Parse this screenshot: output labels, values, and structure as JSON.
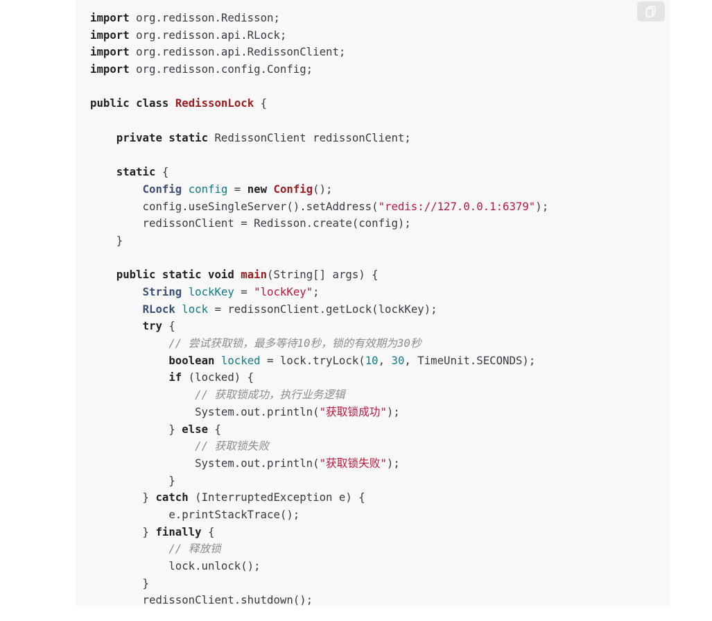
{
  "copy_button": {
    "icon": "copy-icon"
  },
  "code_lines": [
    [
      [
        "kw",
        "import"
      ],
      [
        "pl",
        " org.redisson.Redisson;"
      ]
    ],
    [
      [
        "kw",
        "import"
      ],
      [
        "pl",
        " org.redisson.api.RLock;"
      ]
    ],
    [
      [
        "kw",
        "import"
      ],
      [
        "pl",
        " org.redisson.api.RedissonClient;"
      ]
    ],
    [
      [
        "kw",
        "import"
      ],
      [
        "pl",
        " org.redisson.config.Config;"
      ]
    ],
    [],
    [
      [
        "kw",
        "public"
      ],
      [
        "pl",
        " "
      ],
      [
        "kw",
        "class"
      ],
      [
        "pl",
        " "
      ],
      [
        "cls",
        "RedissonLock"
      ],
      [
        "pl",
        " {"
      ]
    ],
    [],
    [
      [
        "pl",
        "    "
      ],
      [
        "kw",
        "private"
      ],
      [
        "pl",
        " "
      ],
      [
        "kw",
        "static"
      ],
      [
        "pl",
        " RedissonClient redissonClient;"
      ]
    ],
    [],
    [
      [
        "pl",
        "    "
      ],
      [
        "kw",
        "static"
      ],
      [
        "pl",
        " {"
      ]
    ],
    [
      [
        "pl",
        "        "
      ],
      [
        "ty",
        "Config"
      ],
      [
        "pl",
        " "
      ],
      [
        "var",
        "config"
      ],
      [
        "pl",
        " = "
      ],
      [
        "kw",
        "new"
      ],
      [
        "pl",
        " "
      ],
      [
        "cls",
        "Config"
      ],
      [
        "pl",
        "();"
      ]
    ],
    [
      [
        "pl",
        "        config.useSingleServer().setAddress("
      ],
      [
        "str",
        "\"redis://127.0.0.1:6379\""
      ],
      [
        "pl",
        ");"
      ]
    ],
    [
      [
        "pl",
        "        redissonClient = Redisson.create(config);"
      ]
    ],
    [
      [
        "pl",
        "    }"
      ]
    ],
    [],
    [
      [
        "pl",
        "    "
      ],
      [
        "kw",
        "public"
      ],
      [
        "pl",
        " "
      ],
      [
        "kw",
        "static"
      ],
      [
        "pl",
        " "
      ],
      [
        "kw",
        "void"
      ],
      [
        "pl",
        " "
      ],
      [
        "fn",
        "main"
      ],
      [
        "pl",
        "(String[] args) {"
      ]
    ],
    [
      [
        "pl",
        "        "
      ],
      [
        "ty",
        "String"
      ],
      [
        "pl",
        " "
      ],
      [
        "var",
        "lockKey"
      ],
      [
        "pl",
        " = "
      ],
      [
        "str",
        "\"lockKey\""
      ],
      [
        "pl",
        ";"
      ]
    ],
    [
      [
        "pl",
        "        "
      ],
      [
        "ty",
        "RLock"
      ],
      [
        "pl",
        " "
      ],
      [
        "var",
        "lock"
      ],
      [
        "pl",
        " = redissonClient.getLock(lockKey);"
      ]
    ],
    [
      [
        "pl",
        "        "
      ],
      [
        "kw",
        "try"
      ],
      [
        "pl",
        " {"
      ]
    ],
    [
      [
        "pl",
        "            "
      ],
      [
        "cmt",
        "// 尝试获取锁，最多等待10秒，锁的有效期为30秒"
      ]
    ],
    [
      [
        "pl",
        "            "
      ],
      [
        "kw",
        "boolean"
      ],
      [
        "pl",
        " "
      ],
      [
        "var",
        "locked"
      ],
      [
        "pl",
        " = lock.tryLock("
      ],
      [
        "num",
        "10"
      ],
      [
        "pl",
        ", "
      ],
      [
        "num",
        "30"
      ],
      [
        "pl",
        ", TimeUnit.SECONDS);"
      ]
    ],
    [
      [
        "pl",
        "            "
      ],
      [
        "kw",
        "if"
      ],
      [
        "pl",
        " (locked) {"
      ]
    ],
    [
      [
        "pl",
        "                "
      ],
      [
        "cmt",
        "// 获取锁成功，执行业务逻辑"
      ]
    ],
    [
      [
        "pl",
        "                System.out.println("
      ],
      [
        "str",
        "\"获取锁成功\""
      ],
      [
        "pl",
        ");"
      ]
    ],
    [
      [
        "pl",
        "            } "
      ],
      [
        "kw",
        "else"
      ],
      [
        "pl",
        " {"
      ]
    ],
    [
      [
        "pl",
        "                "
      ],
      [
        "cmt",
        "// 获取锁失败"
      ]
    ],
    [
      [
        "pl",
        "                System.out.println("
      ],
      [
        "str",
        "\"获取锁失败\""
      ],
      [
        "pl",
        ");"
      ]
    ],
    [
      [
        "pl",
        "            }"
      ]
    ],
    [
      [
        "pl",
        "        } "
      ],
      [
        "kw",
        "catch"
      ],
      [
        "pl",
        " (InterruptedException e) {"
      ]
    ],
    [
      [
        "pl",
        "            e.printStackTrace();"
      ]
    ],
    [
      [
        "pl",
        "        } "
      ],
      [
        "kw",
        "finally"
      ],
      [
        "pl",
        " {"
      ]
    ],
    [
      [
        "pl",
        "            "
      ],
      [
        "cmt",
        "// 释放锁"
      ]
    ],
    [
      [
        "pl",
        "            lock.unlock();"
      ]
    ],
    [
      [
        "pl",
        "        }"
      ]
    ],
    [
      [
        "pl",
        "        redissonClient.shutdown();"
      ]
    ]
  ]
}
